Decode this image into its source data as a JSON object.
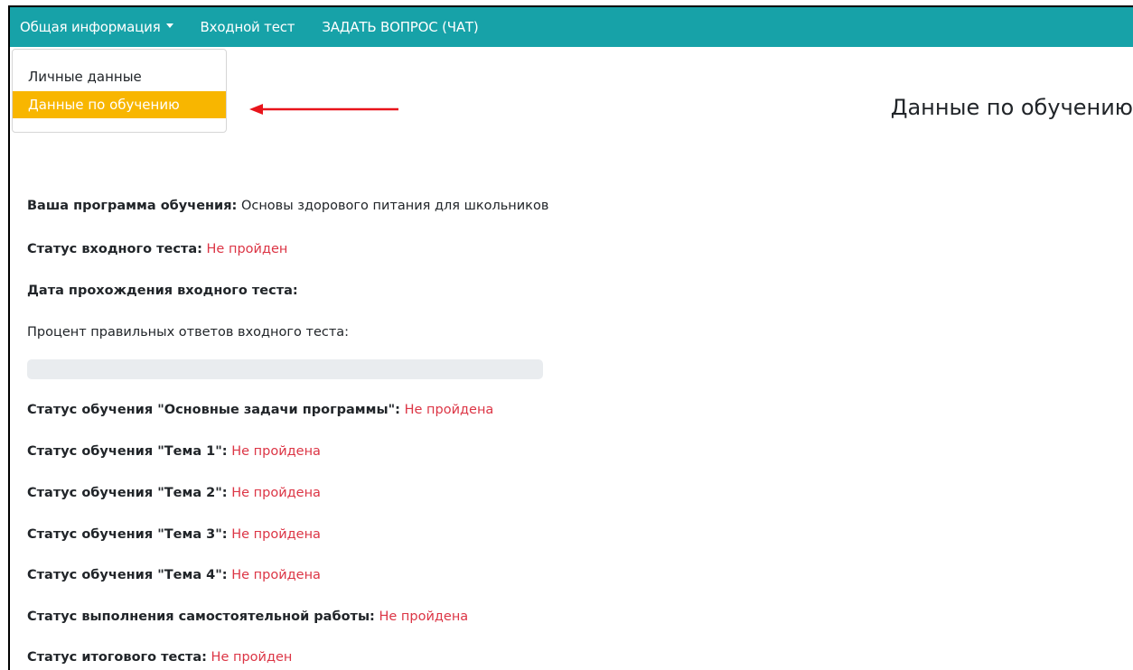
{
  "navbar": {
    "general_info": "Общая информация",
    "entrance_test": "Входной тест",
    "ask_question": "ЗАДАТЬ ВОПРОС (ЧАТ)"
  },
  "dropdown": {
    "personal_data": "Личные данные",
    "training_data": "Данные по обучению"
  },
  "page": {
    "title": "Данные по обучению"
  },
  "fields": {
    "program": {
      "label": "Ваша программа обучения:",
      "value": "Основы здорового питания для школьников"
    },
    "entrance_status": {
      "label": "Статус входного теста:",
      "value": "Не пройден"
    },
    "entrance_date": {
      "label": "Дата прохождения входного теста:",
      "value": ""
    },
    "entrance_percent": {
      "label": "Процент правильных ответов входного теста:"
    },
    "main_tasks": {
      "label": "Статус обучения \"Основные задачи программы\":",
      "value": "Не пройдена"
    },
    "topic1": {
      "label": "Статус обучения \"Тема 1\":",
      "value": "Не пройдена"
    },
    "topic2": {
      "label": "Статус обучения \"Тема 2\":",
      "value": "Не пройдена"
    },
    "topic3": {
      "label": "Статус обучения \"Тема 3\":",
      "value": "Не пройдена"
    },
    "topic4": {
      "label": "Статус обучения \"Тема 4\":",
      "value": "Не пройдена"
    },
    "independent_work": {
      "label": "Статус выполнения самостоятельной работы:",
      "value": "Не пройдена"
    },
    "final_test": {
      "label": "Статус итогового теста:",
      "value": "Не пройден"
    }
  },
  "progress": {
    "percent": 0
  },
  "colors": {
    "navbar": "#17a2a8",
    "active_item": "#f8b600",
    "status_fail": "#dc3545",
    "annotation_arrow": "#e8141b"
  },
  "icons": {
    "dropdown_caret": "caret-down-icon",
    "annotation": "red-arrow-left-icon"
  }
}
